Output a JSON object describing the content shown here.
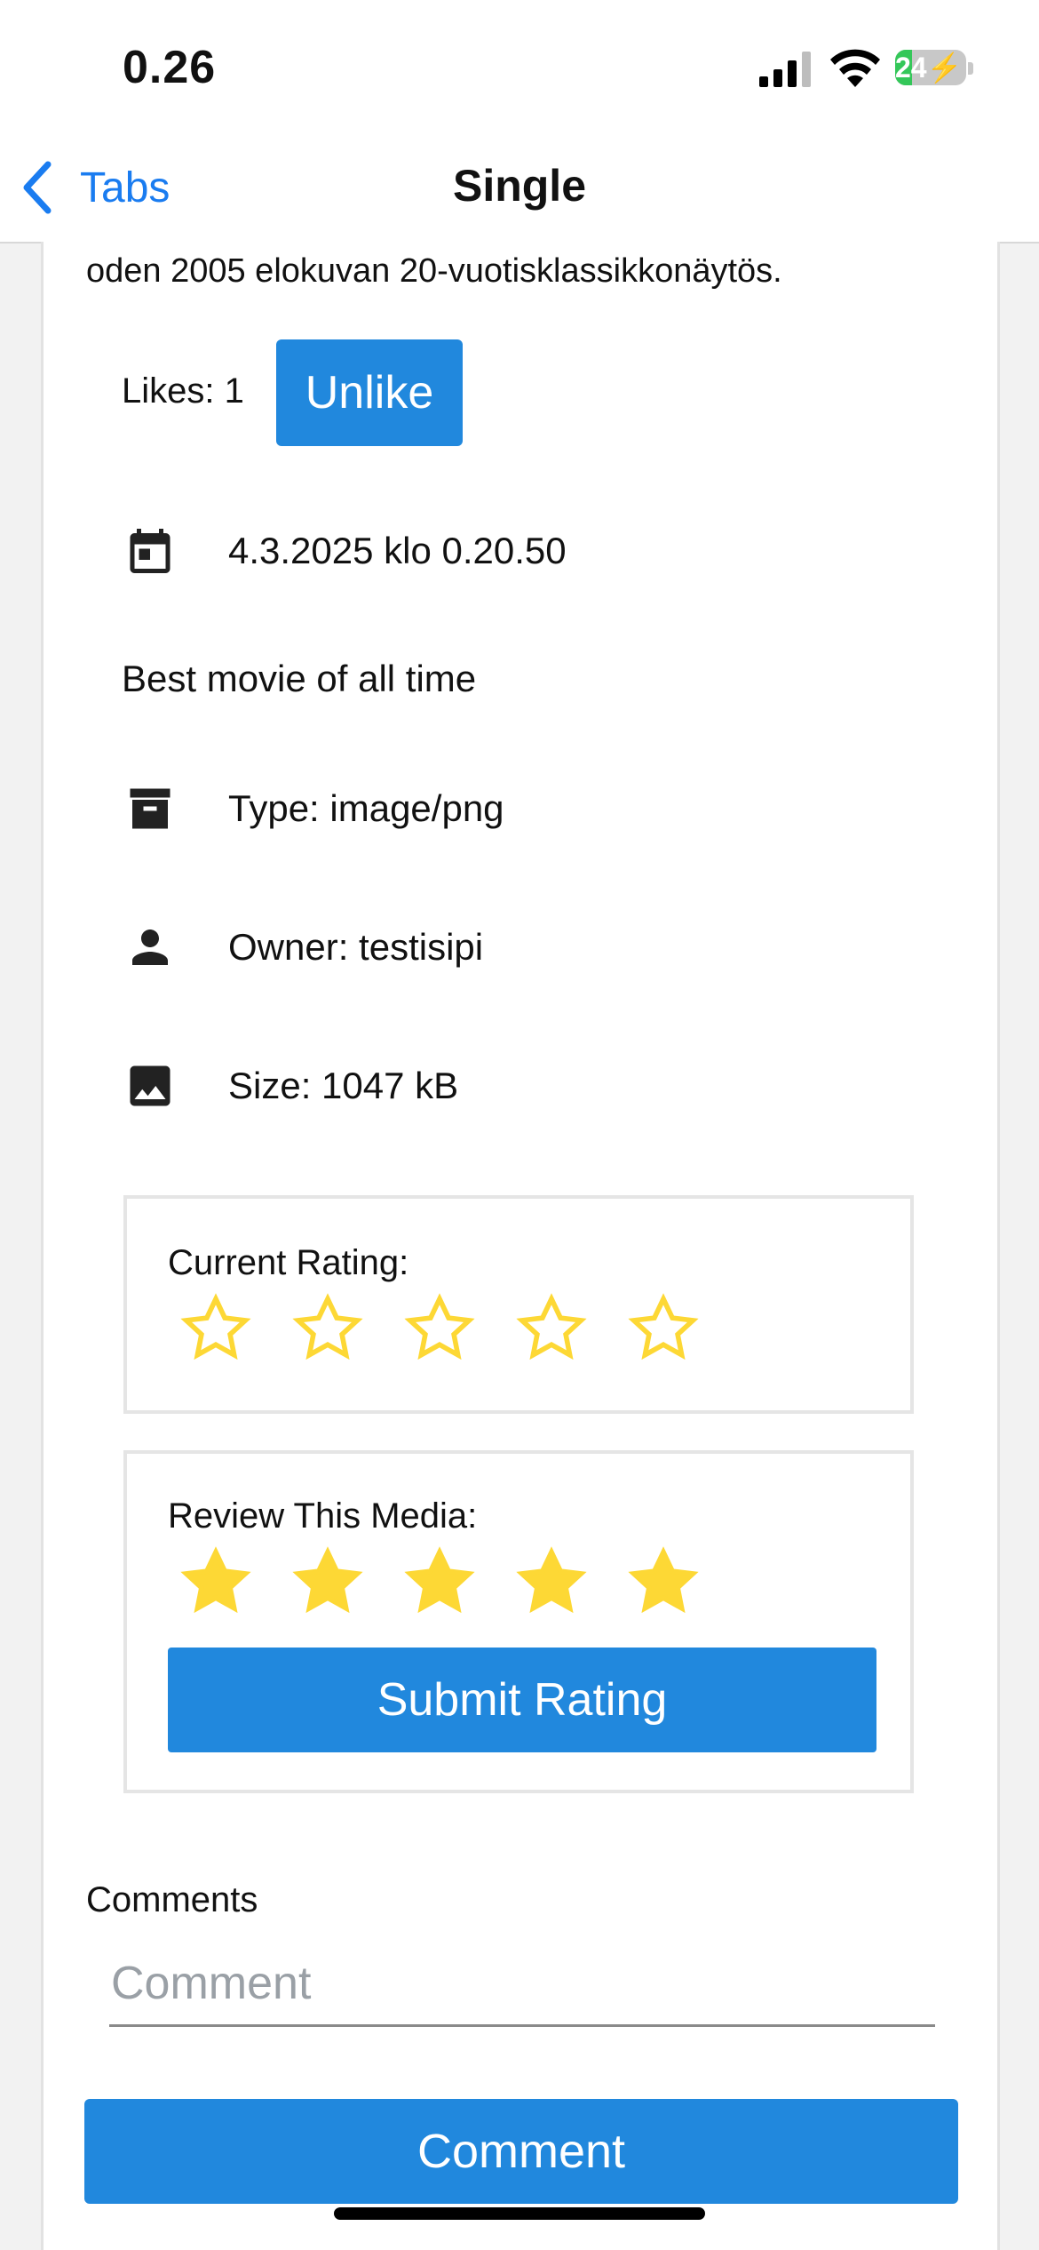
{
  "status_bar": {
    "time": "0.26",
    "battery": "24",
    "battery_level": 0.24
  },
  "nav": {
    "back_label": "Tabs",
    "title": "Single"
  },
  "media": {
    "description_tail": "oden 2005 elokuvan 20-vuotisklassikkonäytös.",
    "likes_label": "Likes: 1",
    "unlike_label": "Unlike",
    "date": "4.3.2025 klo 0.20.50",
    "title": "Best movie of all time",
    "type": "Type: image/png",
    "owner": "Owner: testisipi",
    "size": "Size: 1047 kB"
  },
  "current_rating": {
    "label": "Current Rating:",
    "value": 0,
    "max": 5
  },
  "review": {
    "label": "Review This Media:",
    "value": 5,
    "max": 5,
    "submit_label": "Submit Rating"
  },
  "comments": {
    "label": "Comments",
    "placeholder": "Comment",
    "button_label": "Comment"
  },
  "colors": {
    "accent": "#2188dd",
    "link": "#1a7cf0",
    "star": "#fdd835",
    "battery_green": "#34c759"
  },
  "icons": {
    "date": "calendar-icon",
    "type": "archive-icon",
    "owner": "person-icon",
    "size": "image-icon",
    "back": "chevron-left-icon"
  }
}
